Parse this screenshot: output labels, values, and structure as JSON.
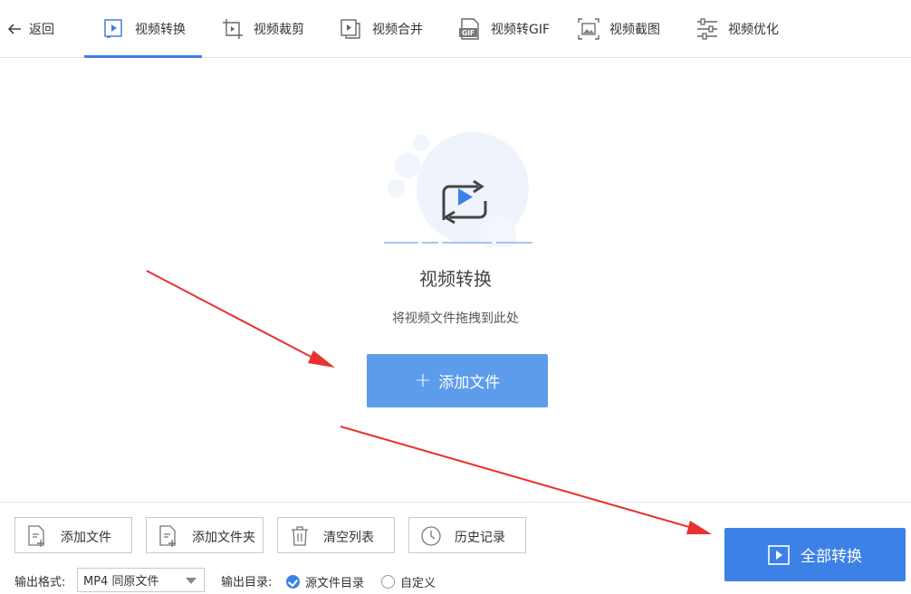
{
  "header": {
    "back_label": "返回",
    "tabs": [
      {
        "label": "视频转换",
        "icon": "video-convert-icon",
        "active": true
      },
      {
        "label": "视频裁剪",
        "icon": "video-crop-icon",
        "active": false
      },
      {
        "label": "视频合并",
        "icon": "video-merge-icon",
        "active": false
      },
      {
        "label": "视频转GIF",
        "icon": "gif-icon",
        "active": false
      },
      {
        "label": "视频截图",
        "icon": "screenshot-icon",
        "active": false
      },
      {
        "label": "视频优化",
        "icon": "optimize-icon",
        "active": false
      }
    ]
  },
  "main": {
    "title": "视频转换",
    "subtitle": "将视频文件拖拽到此处",
    "add_file_label": "添加文件"
  },
  "toolbar": {
    "add_file_label": "添加文件",
    "add_folder_label": "添加文件夹",
    "clear_list_label": "清空列表",
    "history_label": "历史记录"
  },
  "output": {
    "format_label": "输出格式:",
    "format_value": "MP4 同原文件",
    "dir_label": "输出目录:",
    "dir_options": [
      {
        "label": "源文件目录",
        "selected": true
      },
      {
        "label": "自定义",
        "selected": false
      }
    ]
  },
  "convert_all_label": "全部转换",
  "colors": {
    "accent": "#3d80e6",
    "button_light": "#5d9ceb",
    "annotation_arrow": "#e8322f"
  }
}
